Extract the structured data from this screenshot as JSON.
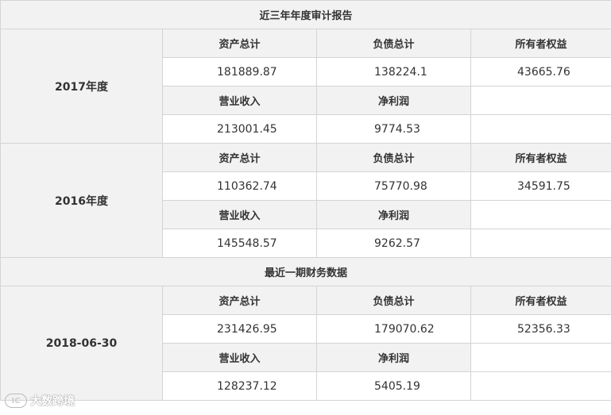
{
  "banners": {
    "audit": "近三年年度审计报告",
    "recent": "最近一期财务数据"
  },
  "labels": {
    "total_assets": "资产总计",
    "total_liabilities": "负债总计",
    "owner_equity": "所有者权益",
    "revenue": "营业收入",
    "net_profit": "净利润"
  },
  "periods": [
    {
      "name": "2017年度",
      "total_assets": "181889.87",
      "total_liabilities": "138224.1",
      "owner_equity": "43665.76",
      "revenue": "213001.45",
      "net_profit": "9774.53"
    },
    {
      "name": "2016年度",
      "total_assets": "110362.74",
      "total_liabilities": "75770.98",
      "owner_equity": "34591.75",
      "revenue": "145548.57",
      "net_profit": "9262.57"
    },
    {
      "name": "2018-06-30",
      "total_assets": "231426.95",
      "total_liabilities": "179070.62",
      "owner_equity": "52356.33",
      "revenue": "128237.12",
      "net_profit": "5405.19"
    }
  ],
  "watermark": {
    "logo": "IC",
    "text": "大数跨境"
  }
}
